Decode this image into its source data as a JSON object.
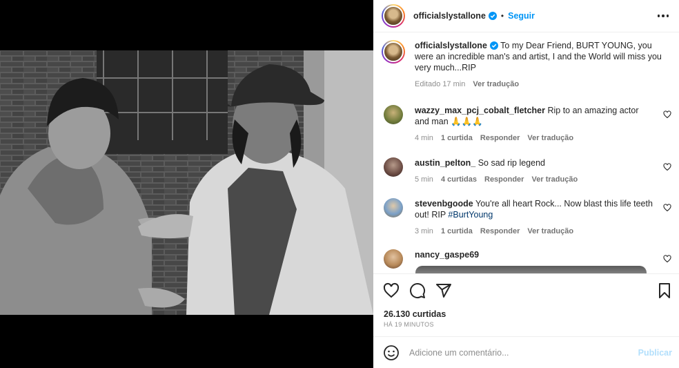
{
  "post": {
    "username": "officialslystallone",
    "follow_label": "Seguir",
    "caption": "To my Dear Friend, BURT YOUNG, you were an incredible man's and artist, I and the World will miss you very much...RIP",
    "edited_label": "Editado",
    "time": "17 min",
    "translate_label": "Ver tradução"
  },
  "comments": [
    {
      "username": "wazzy_max_pcj_cobalt_fletcher",
      "text": "Rip to an amazing actor and man 🙏🙏🙏",
      "time": "4 min",
      "likes": "1 curtida",
      "reply_label": "Responder",
      "translate_label": "Ver tradução"
    },
    {
      "username": "austin_pelton_",
      "text": "So sad rip legend",
      "time": "5 min",
      "likes": "4 curtidas",
      "reply_label": "Responder",
      "translate_label": "Ver tradução"
    },
    {
      "username": "stevenbgoode",
      "text": "You're all heart Rock... Now blast this life teeth out! RIP ",
      "hashtag": "#BurtYoung",
      "time": "3 min",
      "likes": "1 curtida",
      "reply_label": "Responder",
      "translate_label": "Ver tradução"
    },
    {
      "username": "nancy_gaspe69",
      "text": ""
    }
  ],
  "footer": {
    "likes": "26.130 curtidas",
    "posted": "HÁ 19 MINUTOS",
    "comment_placeholder": "Adicione um comentário...",
    "publish_label": "Publicar"
  },
  "colors": {
    "accent": "#0095f6",
    "verified": "#0095f6",
    "publish_disabled": "#b2dffc"
  },
  "icons": [
    "more-icon",
    "verified-icon",
    "heart-icon",
    "comment-icon",
    "share-icon",
    "bookmark-icon",
    "emoji-icon"
  ]
}
